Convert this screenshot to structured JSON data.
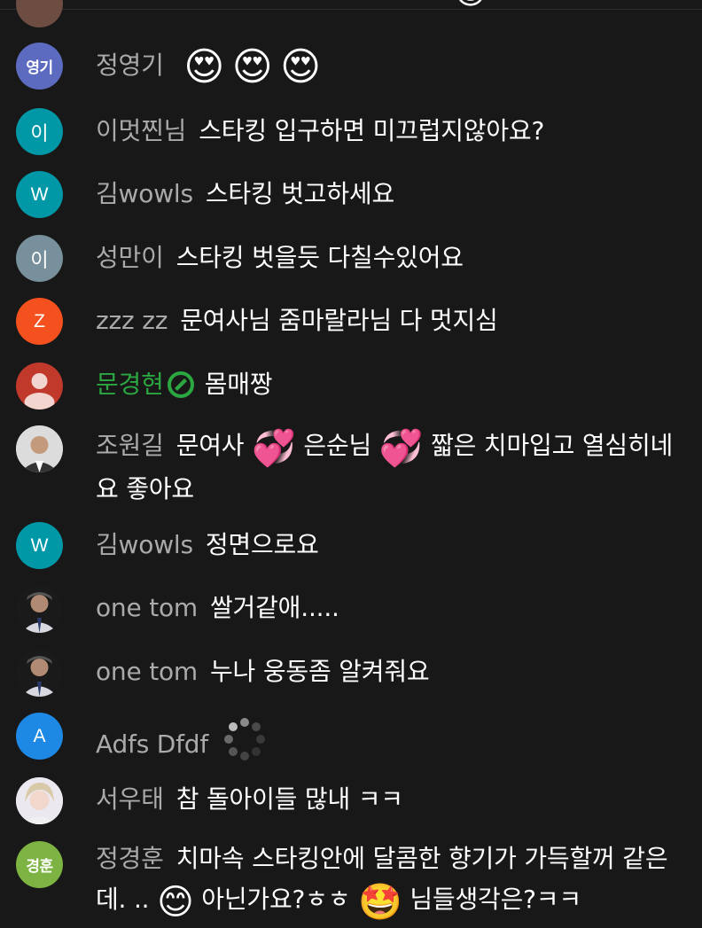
{
  "chat": {
    "messages": [
      {
        "author": "정영기",
        "avatar_text": "영기",
        "avatar_color": "#5c6bc0",
        "text": "",
        "emoji": [
          "😍",
          "😍",
          "😍"
        ]
      },
      {
        "author": "이멋찐님",
        "avatar_text": "이",
        "avatar_color": "#0097a7",
        "text": "스타킹 입구하면 미끄럽지않아요?"
      },
      {
        "author": "김wowls",
        "avatar_text": "W",
        "avatar_color": "#0097a7",
        "text": "스타킹 벗고하세요"
      },
      {
        "author": "성만이",
        "avatar_text": "이",
        "avatar_color": "#78909c",
        "text": "스타킹 벗을듯 다칠수있어요"
      },
      {
        "author": "zzz zz",
        "avatar_text": "Z",
        "avatar_color": "#f4511e",
        "text": "문여사님 줌마랄라님 다 멋지심"
      },
      {
        "author": "문경현",
        "avatar_color": "#c0392b",
        "text": "몸매짱",
        "author_color": "#2ba640"
      },
      {
        "author": "조원길",
        "text_parts": [
          "문여사",
          "💞",
          "은순님",
          "💞",
          "짧은 치마입고 열심히네요 좋아요"
        ]
      },
      {
        "author": "김wowls",
        "avatar_text": "W",
        "avatar_color": "#0097a7",
        "text": "정면으로요"
      },
      {
        "author": "one tom",
        "text": "쌀거같애....."
      },
      {
        "author": "one tom",
        "text": "누나 웅동좀 알켜줘요"
      },
      {
        "author": "Adfs Dfdf",
        "avatar_text": "A",
        "avatar_color": "#1e88e5",
        "text": ""
      },
      {
        "author": "서우태",
        "text": "참 돌아이들 많내 ㅋㅋ"
      },
      {
        "author": "정경훈",
        "avatar_text": "경훈",
        "avatar_color": "#7cb342",
        "text_parts": [
          "치마속 스타킹안에 달콤한 향기가 가득할꺼 같은데. ..",
          "😊",
          "아닌가요?ㅎㅎ",
          "🤩",
          "님들생각은?ㅋㅋ"
        ]
      }
    ]
  }
}
